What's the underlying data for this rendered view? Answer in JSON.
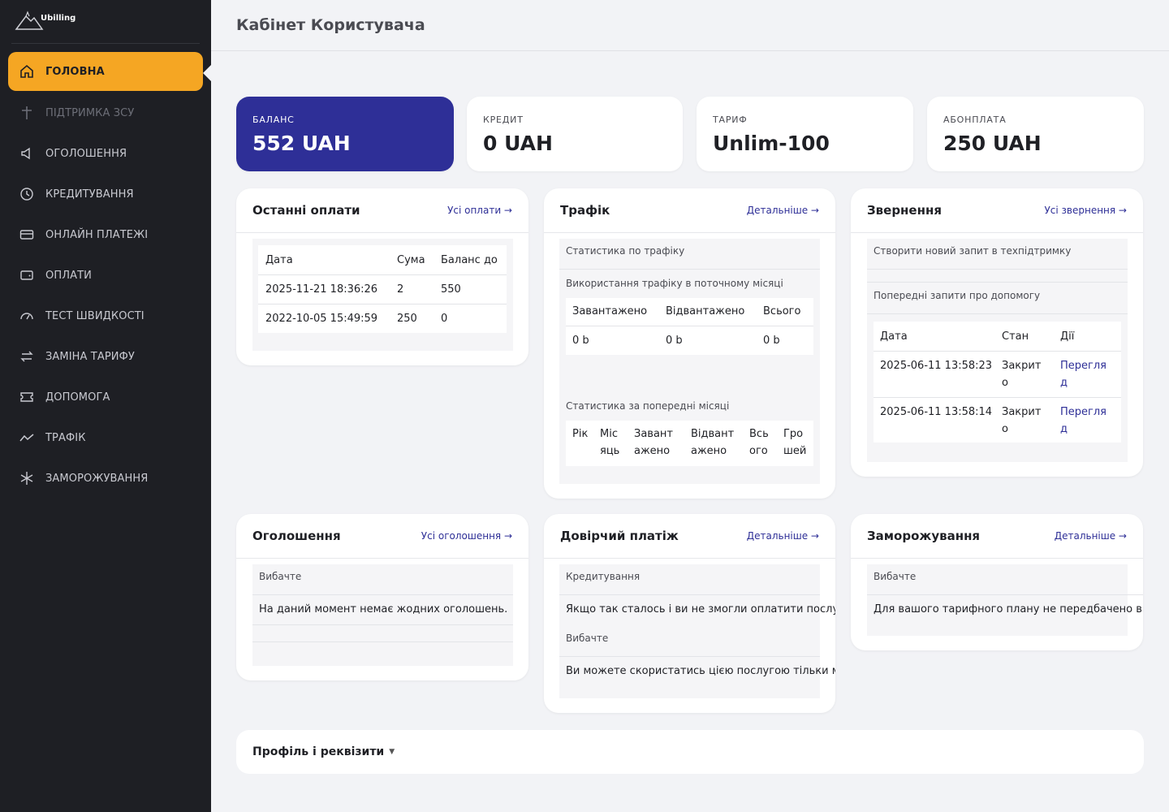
{
  "app": {
    "logo_text": "Ubilling",
    "page_title": "Кабінет Користувача"
  },
  "sidebar": {
    "items": [
      {
        "label": "ГОЛОВНА",
        "icon": "home-icon"
      },
      {
        "label": "ПІДТРИМКА ЗСУ",
        "icon": "cross-icon"
      },
      {
        "label": "ОГОЛОШЕННЯ",
        "icon": "megaphone-icon"
      },
      {
        "label": "КРЕДИТУВАННЯ",
        "icon": "clock-icon"
      },
      {
        "label": "ОНЛАЙН ПЛАТЕЖІ",
        "icon": "card-icon"
      },
      {
        "label": "ОПЛАТИ",
        "icon": "wallet-icon"
      },
      {
        "label": "ТЕСТ ШВИДКОСТІ",
        "icon": "gauge-icon"
      },
      {
        "label": "ЗАМІНА ТАРИФУ",
        "icon": "swap-icon"
      },
      {
        "label": "ДОПОМОГА",
        "icon": "ticket-icon"
      },
      {
        "label": "ТРАФІК",
        "icon": "chart-line-icon"
      },
      {
        "label": "ЗАМОРОЖУВАННЯ",
        "icon": "snowflake-icon"
      }
    ]
  },
  "stats": [
    {
      "label": "БАЛАНС",
      "value": "552 UAH"
    },
    {
      "label": "КРЕДИТ",
      "value": "0 UAH"
    },
    {
      "label": "ТАРИФ",
      "value": "Unlim-100"
    },
    {
      "label": "АБОНПЛАТА",
      "value": "250 UAH"
    }
  ],
  "payments": {
    "title": "Останні оплати",
    "link": "Усі оплати →",
    "headers": [
      "Дата",
      "Сума",
      "Баланс до"
    ],
    "rows": [
      [
        "2025-11-21 18:36:26",
        "2",
        "550"
      ],
      [
        "2022-10-05 15:49:59",
        "250",
        "0"
      ]
    ]
  },
  "traffic": {
    "title": "Трафік",
    "link": "Детальніше →",
    "stats_title": "Статистика по трафіку",
    "current_title": "Використання трафіку в поточному місяці",
    "current_headers": [
      "Завантажено",
      "Відвантажено",
      "Всього"
    ],
    "current_values": [
      "0 b",
      "0 b",
      "0 b"
    ],
    "prev_title": "Статистика за попередні місяці",
    "prev_headers": [
      "Рік",
      "Міс яць",
      "Завант ажено",
      "Відвант ажено",
      "Всь ого",
      "Гро шей"
    ]
  },
  "tickets": {
    "title": "Звернення",
    "link": "Усі звернення →",
    "new_request": "Створити новий запит в техпідтримку",
    "previous": "Попередні запити про допомогу",
    "headers": [
      "Дата",
      "Стан",
      "Дії"
    ],
    "rows": [
      [
        "2025-06-11 13:58:23",
        "Закрит о",
        "Перегля д"
      ],
      [
        "2025-06-11 13:58:14",
        "Закрит о",
        "Перегля д"
      ]
    ]
  },
  "announcements": {
    "title": "Оголошення",
    "link": "Усі оголошення →",
    "sub": "Вибачте",
    "text": "На даний момент немає жодних оголошень."
  },
  "trust": {
    "title": "Довірчий платіж",
    "link": "Детальніше →",
    "sub1": "Кредитування",
    "text1": "Якщо так сталось і ви не змогли оплатити послугу",
    "sub2": "Вибачте",
    "text2": "Ви можете скористатись цією послугою тільки між"
  },
  "freeze": {
    "title": "Заморожування",
    "link": "Детальніше →",
    "sub": "Вибачте",
    "text": "Для вашого тарифного плану не передбачено вико"
  },
  "profile": {
    "label": "Профіль і реквізити",
    "caret": "▼"
  }
}
